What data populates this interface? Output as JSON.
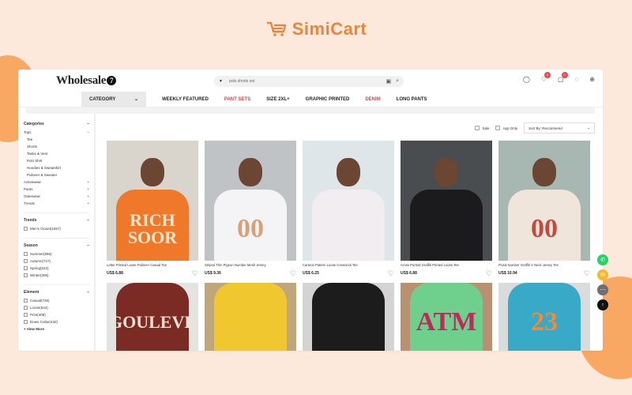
{
  "brand": {
    "name": "SimiCart",
    "color": "#e8863a"
  },
  "store": {
    "logo_text": "Wholesale",
    "logo_badge": "7",
    "search_value": "polo shorts set",
    "cart_count": "0",
    "wishlist_count": "0"
  },
  "nav": {
    "category_label": "CATEGORY",
    "items": [
      {
        "label": "WEEKLY FEATURED",
        "highlight": false
      },
      {
        "label": "PANT SETS",
        "highlight": true
      },
      {
        "label": "SIZE 2XL+",
        "highlight": false
      },
      {
        "label": "GRAPHIC PRINTED",
        "highlight": false
      },
      {
        "label": "DENIM",
        "highlight": true
      },
      {
        "label": "LONG PANTS",
        "highlight": false
      }
    ]
  },
  "sidebar": {
    "categories_title": "Categories",
    "tops_label": "Tops",
    "tops_items": [
      "Tee",
      "Shorts",
      "Tanks & Vest",
      "Polo Shirt",
      "Hoodies & Sweatshirt",
      "Pullover & Sweater"
    ],
    "collapsed": [
      "Activewear",
      "Pants",
      "Outerwear",
      "Trends"
    ],
    "trends_title": "Trends",
    "trends_items": [
      "Men's Closet(1557)"
    ],
    "season_title": "Season",
    "season_items": [
      "Summer(856)",
      "Autumn(727)",
      "Spring(622)",
      "Winter(306)"
    ],
    "element_title": "Element",
    "element_items": [
      "Casual(725)",
      "Loose(644)",
      "Print(408)",
      "Down Collar(432)"
    ],
    "view_more": "+ View More"
  },
  "toolbar": {
    "sale_label": "Sale",
    "app_only_label": "App Only",
    "sort_label": "Sort By:",
    "sort_value": "Recommend"
  },
  "products": [
    {
      "title": "Letter Printed Loose Pullover Casual Tee",
      "price": "US$ 6.88",
      "shirt_text": "RICH\nSOOR",
      "bg": "#d9d4cc",
      "shirt": "#f0782a",
      "text_color": "#f8e8d2"
    },
    {
      "title": "Striped Thin Pigeon Number Mesh Jersey",
      "price": "US$ 9.36",
      "shirt_text": "00",
      "bg": "#bfc3c6",
      "shirt": "#f4f4f6",
      "text_color": "#d6a176"
    },
    {
      "title": "Cartoon Pattern Loose Crewneck Tee",
      "price": "US$ 6.25",
      "shirt_text": "",
      "bg": "#dfe6ea",
      "shirt": "#f1edf0",
      "text_color": "#8c4a86"
    },
    {
      "title": "Cross Portrait Graffiti Printed Loose Tee",
      "price": "US$ 6.88",
      "shirt_text": "",
      "bg": "#4a4d4f",
      "shirt": "#1b1b1d",
      "text_color": "#eaeaea"
    },
    {
      "title": "Floral Number Graffiti V Neck Jersey Tee",
      "price": "US$ 10.94",
      "shirt_text": "00",
      "bg": "#a6b8b1",
      "shirt": "#efe5da",
      "text_color": "#c34a3f"
    },
    {
      "title": "",
      "price": "",
      "shirt_text": "GOULEVE",
      "bg": "#e3e3e1",
      "shirt": "#7b2b24",
      "text_color": "#f2e2d6"
    },
    {
      "title": "",
      "price": "",
      "shirt_text": "",
      "bg": "#c0a77b",
      "shirt": "#f0c72f",
      "text_color": "#2a44a8"
    },
    {
      "title": "",
      "price": "",
      "shirt_text": "",
      "bg": "#d6d3d3",
      "shirt": "#1c1c1d",
      "text_color": "#ffffff"
    },
    {
      "title": "",
      "price": "",
      "shirt_text": "ATM",
      "bg": "#b99070",
      "shirt": "#6fcf8d",
      "text_color": "#bb2c5b"
    },
    {
      "title": "",
      "price": "",
      "shirt_text": "23",
      "bg": "#d8dcdd",
      "shirt": "#39a9c8",
      "text_color": "#f08a3c"
    }
  ],
  "float_buttons": [
    {
      "name": "whatsapp-icon",
      "color": "#25d366",
      "glyph": "✆"
    },
    {
      "name": "chat-icon",
      "color": "#f5b82e",
      "glyph": "✉"
    },
    {
      "name": "more-icon",
      "color": "#6f6f6f",
      "glyph": "⋯"
    },
    {
      "name": "back-to-top-icon",
      "color": "#111111",
      "glyph": "↑"
    }
  ]
}
